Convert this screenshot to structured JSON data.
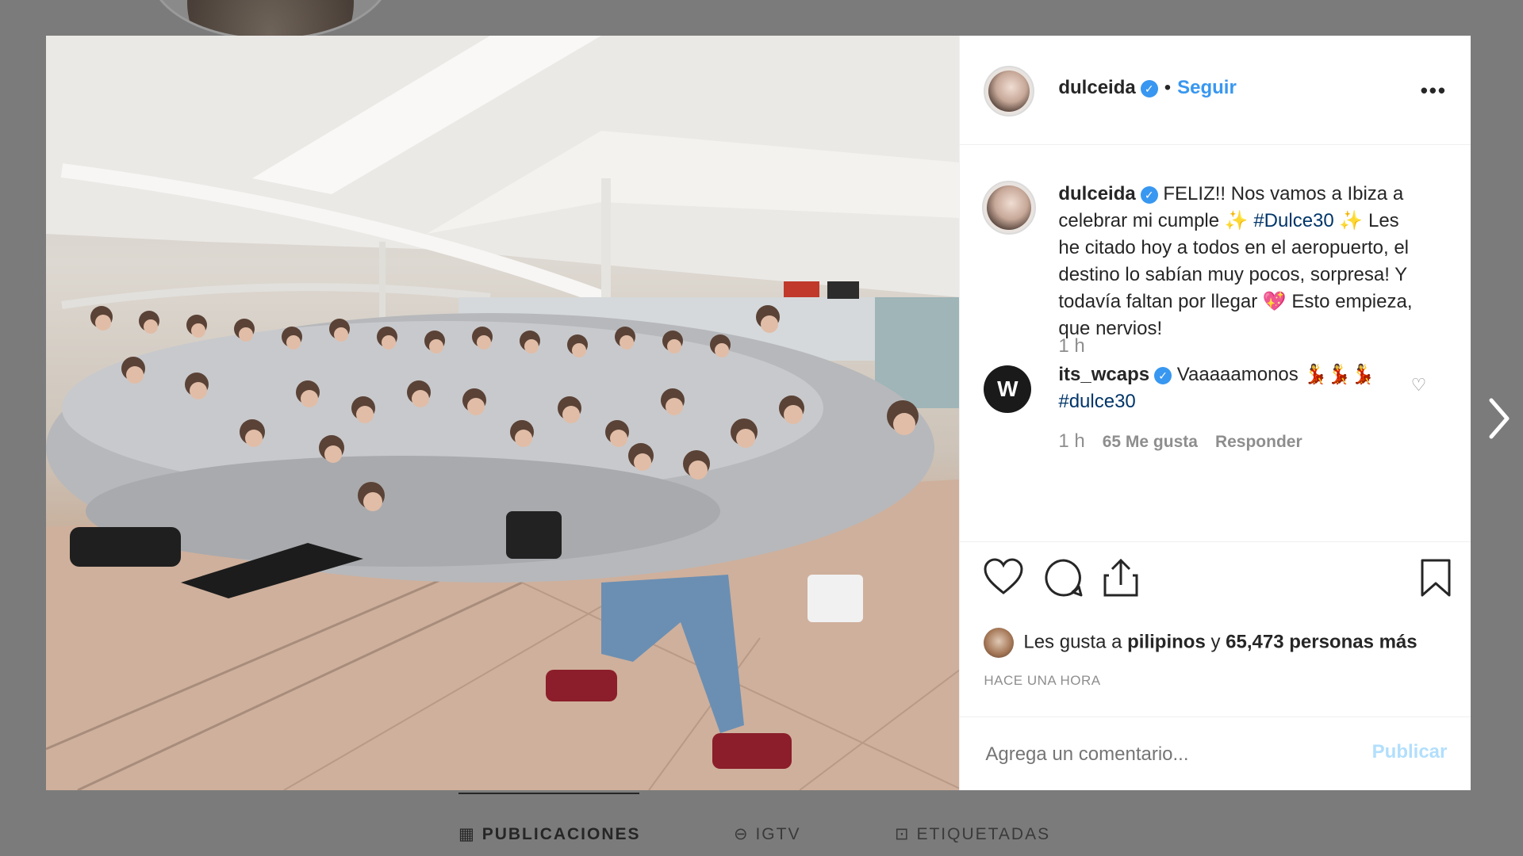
{
  "post": {
    "username": "dulceida",
    "follow_label": "Seguir",
    "more_label": "•••",
    "caption_parts": {
      "line1": "FELIZ!! Nos vamos a Ibiza a celebrar mi cumple",
      "hashtag1": "#Dulce30",
      "rest": "Les he citado hoy a todos en el aeropuerto, el destino lo sabían muy pocos, sorpresa! Y todavía faltan por llegar",
      "end": "Esto empieza, que nervios!"
    },
    "caption_time": "1 h",
    "likes_user": "pilipinos",
    "likes_prefix": "Les gusta a",
    "likes_middle": "y",
    "likes_count": "65,473 personas más",
    "time_ago": "HACE UNA HORA",
    "comment_placeholder": "Agrega un comentario...",
    "publish_label": "Publicar"
  },
  "comment": {
    "username": "its_wcaps",
    "text": "Vaaaaamonos",
    "hashtag": "#dulce30",
    "time": "1 h",
    "likes": "65 Me gusta",
    "reply_label": "Responder"
  },
  "tabs": [
    {
      "label": "PUBLICACIONES",
      "icon": "grid-icon"
    },
    {
      "label": "IGTV",
      "icon": "igtv-icon"
    },
    {
      "label": "ETIQUETADAS",
      "icon": "tagged-icon"
    }
  ],
  "colors": {
    "link": "#3897f0",
    "hashtag": "#003569",
    "muted": "#8e8e8e",
    "overlay": "#7b7b7b"
  }
}
